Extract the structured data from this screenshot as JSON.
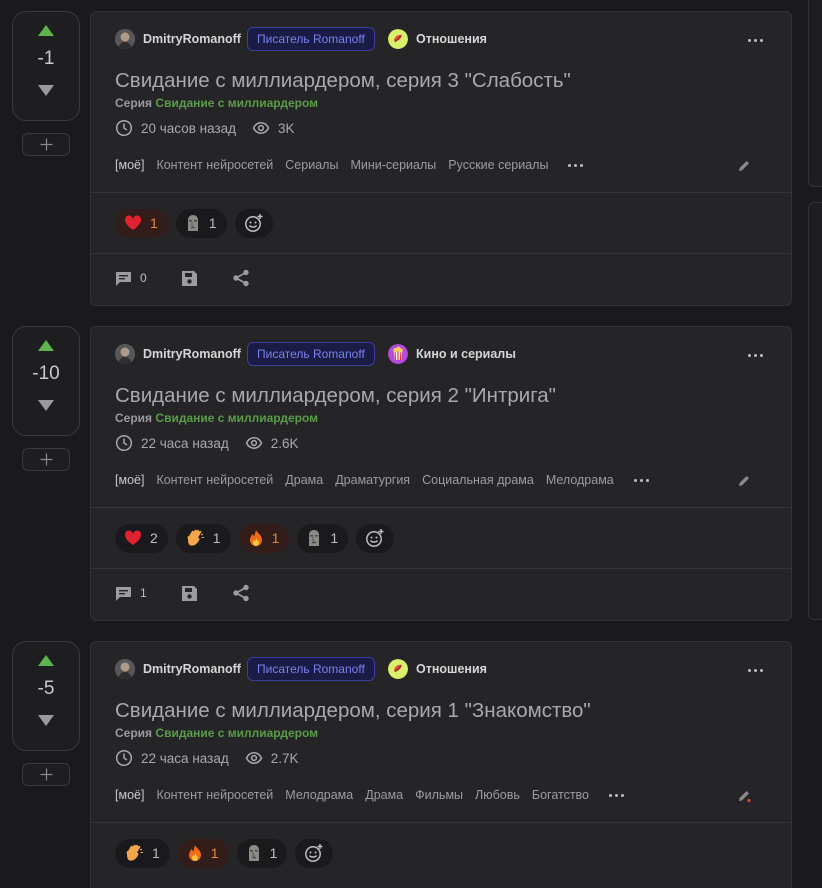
{
  "author": "DmitryRomanoff",
  "author_badge": "Писатель Romanoff",
  "series_label": "Серия",
  "series_name": "Свидание с миллиардером",
  "posts": [
    {
      "score": "-1",
      "community": "Отношения",
      "title": "Свидание с миллиардером, серия 3 \"Слабость\"",
      "time": "20 часов назад",
      "views": "3K",
      "tag_mine": "[моё]",
      "tags": [
        "Контент нейросетей",
        "Сериалы",
        "Мини-сериалы",
        "Русские сериалы"
      ],
      "reactions": [
        {
          "icon": "heart-icon",
          "count": "1",
          "active": true
        },
        {
          "icon": "moai-icon",
          "count": "1",
          "active": false
        }
      ],
      "comments": "0"
    },
    {
      "score": "-10",
      "community": "Кино и сериалы",
      "title": "Свидание с миллиардером, серия 2 \"Интрига\"",
      "time": "22 часа назад",
      "views": "2.6K",
      "tag_mine": "[моё]",
      "tags": [
        "Контент нейросетей",
        "Драма",
        "Драматургия",
        "Социальная драма",
        "Мелодрама"
      ],
      "reactions": [
        {
          "icon": "heart-icon",
          "count": "2",
          "active": false
        },
        {
          "icon": "clap-icon",
          "count": "1",
          "active": false
        },
        {
          "icon": "fire-icon",
          "count": "1",
          "active": true
        },
        {
          "icon": "moai-icon",
          "count": "1",
          "active": false
        }
      ],
      "comments": "1"
    },
    {
      "score": "-5",
      "community": "Отношения",
      "title": "Свидание с миллиардером, серия 1 \"Знакомство\"",
      "time": "22 часа назад",
      "views": "2.7K",
      "tag_mine": "[моё]",
      "tags": [
        "Контент нейросетей",
        "Мелодрама",
        "Драма",
        "Фильмы",
        "Любовь",
        "Богатство"
      ],
      "reactions": [
        {
          "icon": "clap-icon",
          "count": "1",
          "active": false
        },
        {
          "icon": "fire-icon",
          "count": "1",
          "active": true
        },
        {
          "icon": "moai-icon",
          "count": "1",
          "active": false
        }
      ],
      "comments": ""
    }
  ],
  "colors": {
    "upvote": "#5fb54d",
    "series_link": "#5a9c47",
    "badge_text": "#7a80ee",
    "active_count": "#e68a3a"
  }
}
